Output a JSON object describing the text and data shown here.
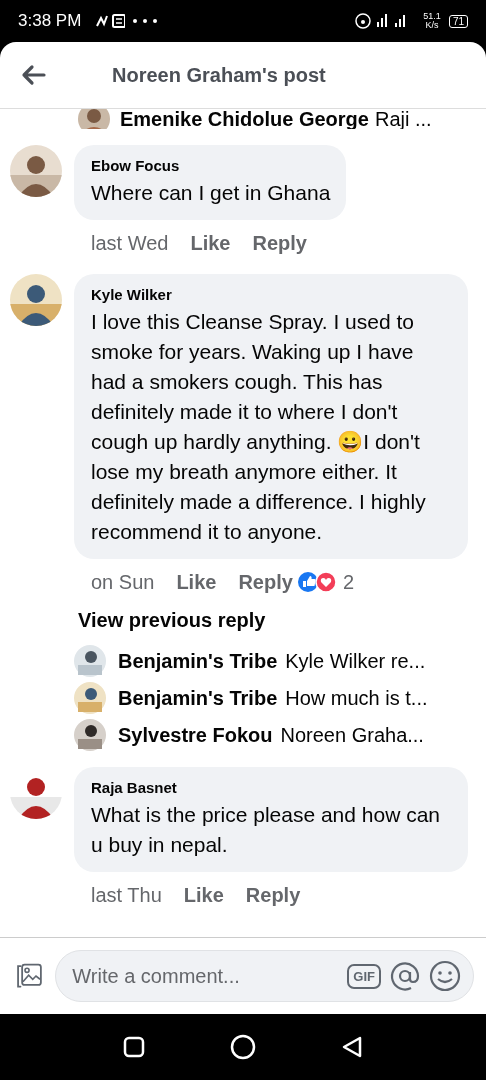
{
  "status_bar": {
    "time": "3:38 PM",
    "speed": "51.1",
    "speed_unit": "K/s",
    "battery": "71"
  },
  "header": {
    "title": "Noreen Graham's post"
  },
  "top_reply": {
    "author": "Emenike Chidolue George",
    "text": "Raji ..."
  },
  "comments": [
    {
      "author": "Ebow Focus",
      "text": "Where can I get in Ghana",
      "time": "last Wed",
      "like": "Like",
      "reply": "Reply"
    },
    {
      "author": "Kyle Wilker",
      "text": "I love this Cleanse Spray. I used to smoke for years. Waking up I have had a smokers cough. This has definitely made it to where I don't cough up hardly anything. 😀I don't lose my breath anymore either. It definitely made a difference. I highly recommend it to anyone.",
      "time": "on Sun",
      "like": "Like",
      "reply": "Reply",
      "reaction_count": "2",
      "view_previous": "View previous reply",
      "replies": [
        {
          "author": "Benjamin's Tribe",
          "text": "Kyle Wilker re..."
        },
        {
          "author": "Benjamin's Tribe",
          "text": "How much is t..."
        },
        {
          "author": "Sylvestre Fokou",
          "text": "Noreen Graha..."
        }
      ]
    },
    {
      "author": "Raja Basnet",
      "text": "What is the price please and how can u buy in nepal.",
      "time": "last Thu",
      "like": "Like",
      "reply": "Reply"
    }
  ],
  "composer": {
    "placeholder": "Write a comment...",
    "gif": "GIF"
  }
}
